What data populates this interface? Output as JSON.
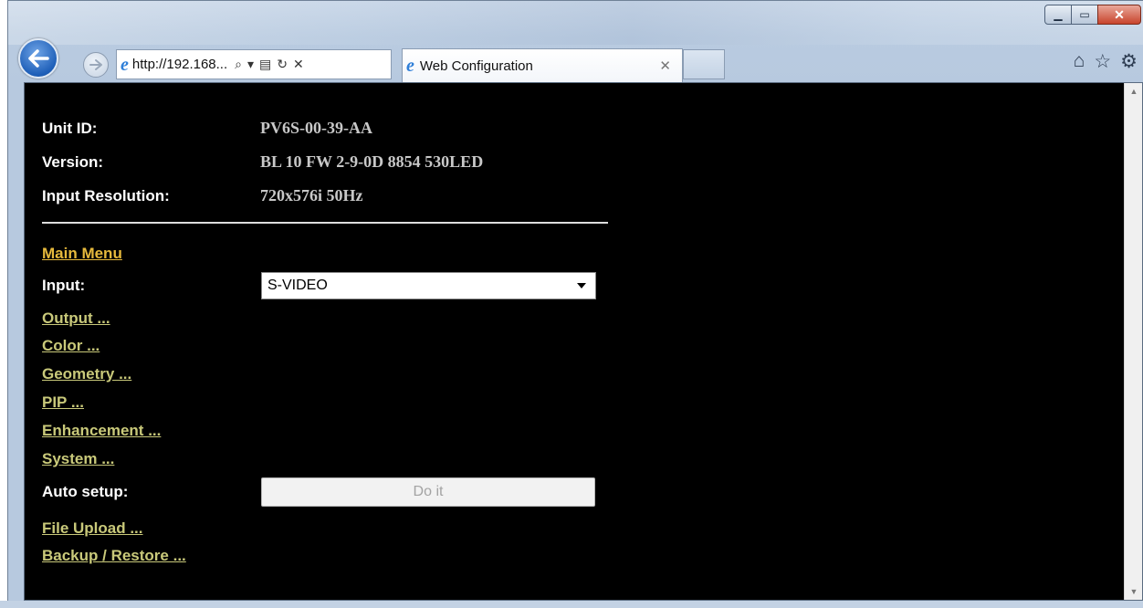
{
  "browser": {
    "address_url": "http://192.168...",
    "tab_title": "Web Configuration",
    "window_controls": [
      "minimize-icon",
      "maximize-icon",
      "close-icon"
    ],
    "command_icons": [
      "home-icon",
      "favorites-star-icon",
      "gear-icon"
    ]
  },
  "info": {
    "unit_id_label": "Unit ID:",
    "unit_id_value": "PV6S-00-39-AA",
    "version_label": "Version:",
    "version_value": "BL 10 FW 2-9-0D 8854 530LED",
    "input_res_label": "Input Resolution:",
    "input_res_value": "720x576i 50Hz"
  },
  "menu": {
    "main_menu": "Main Menu",
    "input_label": "Input:",
    "input_selected": "S-VIDEO",
    "output": "Output ...",
    "color": "Color ...",
    "geometry": "Geometry ...",
    "pip": "PIP ...",
    "enhancement": "Enhancement ...",
    "system": "System ...",
    "auto_setup_label": "Auto setup:",
    "do_it_button": "Do it",
    "file_upload": "File Upload ...",
    "backup_restore": "Backup / Restore ..."
  },
  "colors": {
    "page_background": "#000000",
    "link_color": "#c9c97a",
    "main_menu_color": "#e6b93c"
  }
}
